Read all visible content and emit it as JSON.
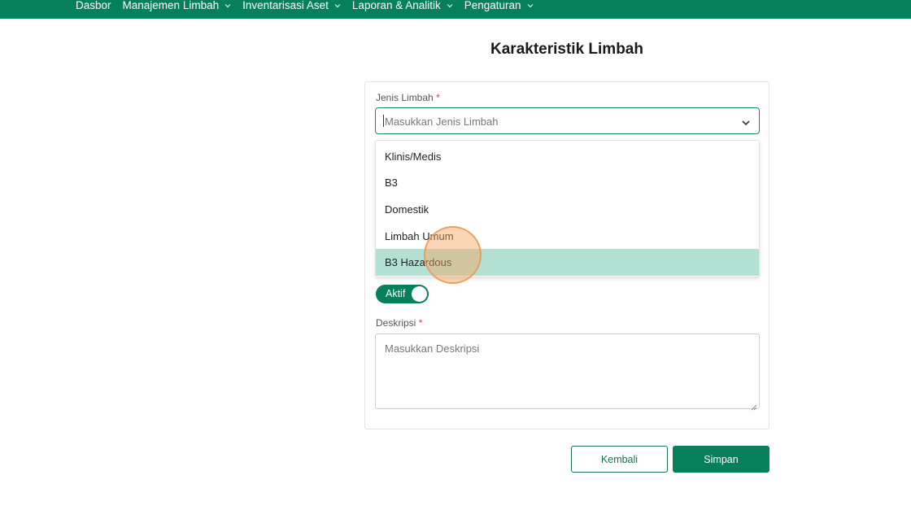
{
  "nav": {
    "items": [
      {
        "label": "Dasbor",
        "has_dropdown": false
      },
      {
        "label": "Manajemen Limbah",
        "has_dropdown": true
      },
      {
        "label": "Inventarisasi Aset",
        "has_dropdown": true
      },
      {
        "label": "Laporan & Analitik",
        "has_dropdown": true
      },
      {
        "label": "Pengaturan",
        "has_dropdown": true
      }
    ]
  },
  "page": {
    "title": "Karakteristik Limbah"
  },
  "form": {
    "jenis_limbah": {
      "label": "Jenis Limbah",
      "required_mark": "*",
      "placeholder": "Masukkan Jenis Limbah",
      "options": [
        "Klinis/Medis",
        "B3",
        "Domestik",
        "Limbah Umum",
        "B3 Hazardous"
      ],
      "highlighted_option": "B3 Hazardous"
    },
    "status_toggle": {
      "label": "Aktif",
      "on": true
    },
    "deskripsi": {
      "label": "Deskripsi",
      "required_mark": "*",
      "placeholder": "Masukkan Deskripsi"
    }
  },
  "buttons": {
    "back_label": "Kembali",
    "save_label": "Simpan"
  },
  "colors": {
    "brand_green": "#06805a",
    "highlight": "#b3e2d4",
    "required": "#e03b3b"
  }
}
